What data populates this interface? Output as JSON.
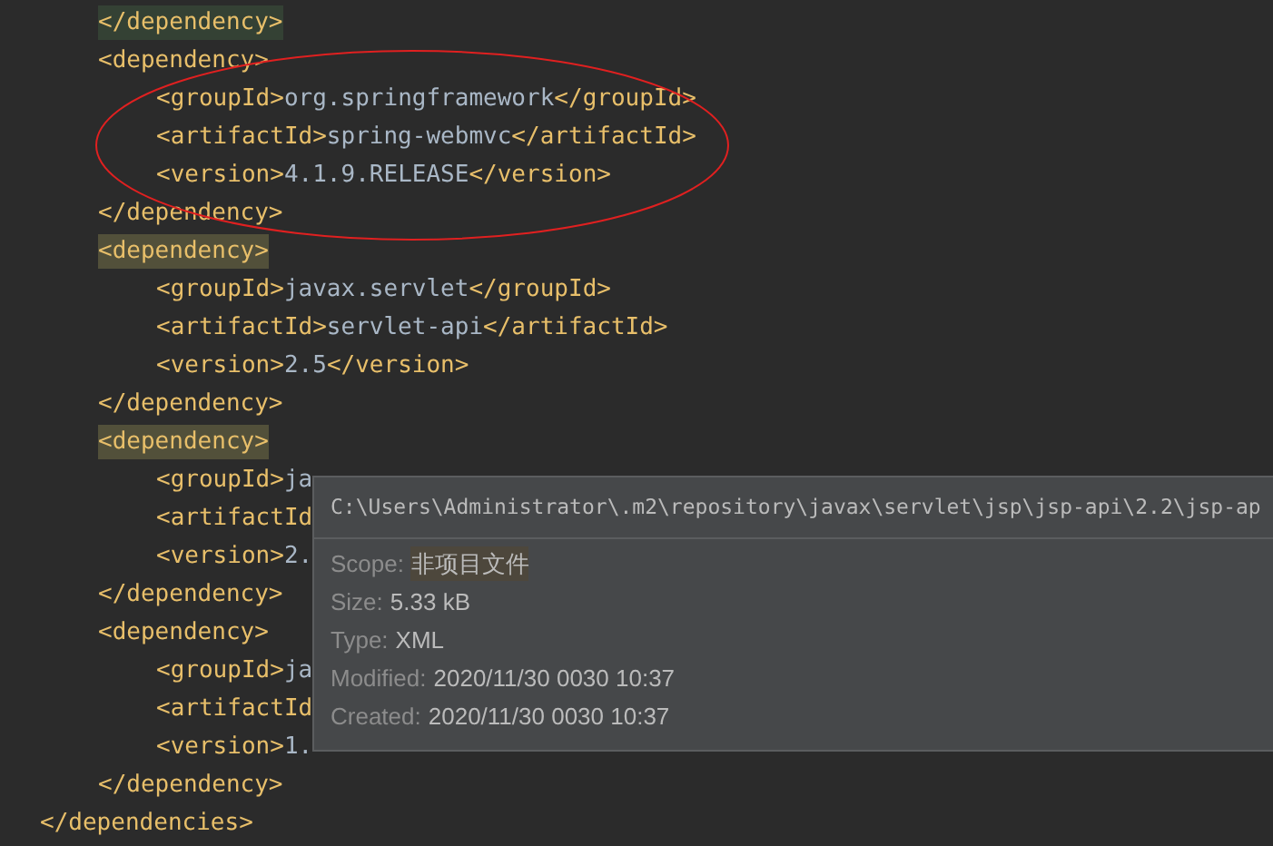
{
  "editor": {
    "root": {
      "kind": "block",
      "close": "</dependencies>",
      "children": [
        {
          "kind": "line",
          "text": "</dependency>",
          "matched": true
        },
        {
          "kind": "block",
          "open": "<dependency>",
          "highlighted": false,
          "close": "</dependency>",
          "children": [
            {
              "kind": "element",
              "open": "<groupId>",
              "value": "org.springframework",
              "close": "</groupId>"
            },
            {
              "kind": "element",
              "open": "<artifactId>",
              "value": "spring-webmvc",
              "close": "</artifactId>"
            },
            {
              "kind": "element",
              "open": "<version>",
              "value": "4.1.9.RELEASE",
              "close": "</version>"
            }
          ]
        },
        {
          "kind": "block",
          "open": "<dependency>",
          "highlighted": true,
          "close": "</dependency>",
          "children": [
            {
              "kind": "element",
              "open": "<groupId>",
              "value": "javax.servlet",
              "close": "</groupId>"
            },
            {
              "kind": "element",
              "open": "<artifactId>",
              "value": "servlet-api",
              "close": "</artifactId>"
            },
            {
              "kind": "element",
              "open": "<version>",
              "value": "2.5",
              "close": "</version>"
            }
          ]
        },
        {
          "kind": "block",
          "open": "<dependency>",
          "highlighted": true,
          "close": "</dependency>",
          "children": [
            {
              "kind": "element",
              "open": "<groupId>",
              "value": "ja"
            },
            {
              "kind": "element",
              "open": "<artifactId"
            },
            {
              "kind": "element",
              "open": "<version>",
              "value": "2."
            }
          ]
        },
        {
          "kind": "block",
          "open": "<dependency>",
          "highlighted": false,
          "close": "</dependency>",
          "children": [
            {
              "kind": "element",
              "open": "<groupId>",
              "value": "ja"
            },
            {
              "kind": "element",
              "open": "<artifactId"
            },
            {
              "kind": "element",
              "open": "<version>",
              "value": "1."
            }
          ]
        }
      ]
    }
  },
  "tooltip": {
    "path": "C:\\Users\\Administrator\\.m2\\repository\\javax\\servlet\\jsp\\jsp-api\\2.2\\jsp-ap",
    "rows": [
      {
        "label": "Scope:",
        "value": "非项目文件",
        "highlighted": true
      },
      {
        "label": "Size:",
        "value": "5.33 kB",
        "highlighted": false
      },
      {
        "label": "Type:",
        "value": "XML",
        "highlighted": false
      },
      {
        "label": "Modified:",
        "value": "2020/11/30 0030 10:37",
        "highlighted": false
      },
      {
        "label": "Created:",
        "value": "2020/11/30 0030 10:37",
        "highlighted": false
      }
    ]
  }
}
